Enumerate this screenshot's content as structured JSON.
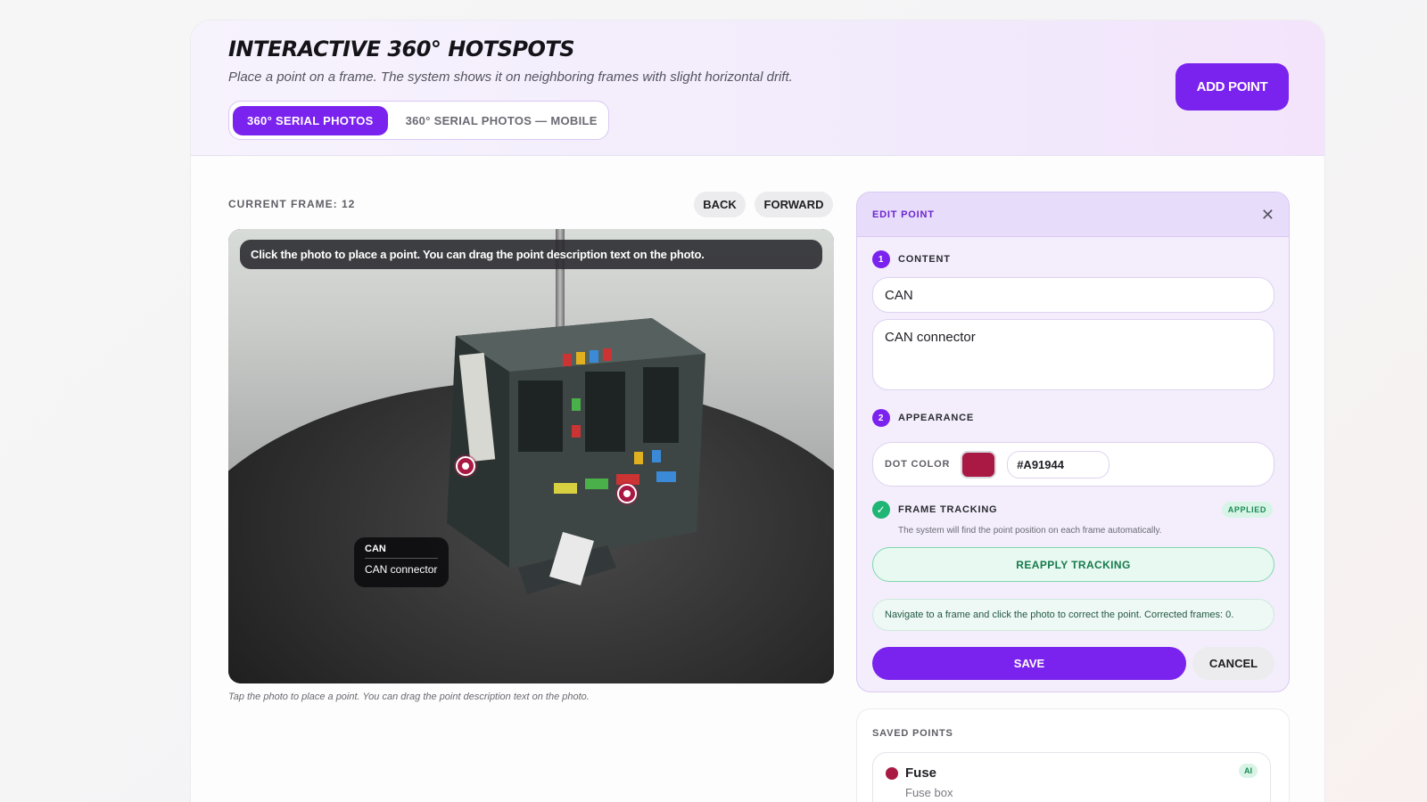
{
  "header": {
    "title": "INTERACTIVE 360° HOTSPOTS",
    "subtitle": "Place a point on a frame. The system shows it on neighboring frames with slight horizontal drift.",
    "add_point_label": "ADD POINT",
    "tabs": [
      {
        "label": "360° SERIAL PHOTOS",
        "active": true
      },
      {
        "label": "360° SERIAL PHOTOS — MOBILE",
        "active": false
      }
    ]
  },
  "viewer": {
    "current_frame_label": "CURRENT FRAME: 12",
    "back_label": "BACK",
    "forward_label": "FORWARD",
    "hint": "Click the photo to place a point. You can drag the point description text on the photo.",
    "caption": "Tap the photo to place a point. You can drag the point description text on the photo.",
    "callout": {
      "title": "CAN",
      "description": "CAN connector"
    }
  },
  "edit_point": {
    "header_label": "EDIT POINT",
    "content": {
      "step": "1",
      "label": "CONTENT",
      "title_value": "CAN",
      "description_value": "CAN connector"
    },
    "appearance": {
      "step": "2",
      "label": "APPEARANCE",
      "dot_color_label": "DOT COLOR",
      "dot_color_value": "#A91944"
    },
    "tracking": {
      "label": "FRAME TRACKING",
      "status": "APPLIED",
      "note": "The system will find the point position on each frame automatically.",
      "reapply_label": "REAPPLY TRACKING",
      "info": "Navigate to a frame and click the photo to correct the point. Corrected frames: 0."
    },
    "save_label": "SAVE",
    "cancel_label": "CANCEL"
  },
  "saved_points": {
    "label": "SAVED POINTS",
    "items": [
      {
        "name": "Fuse",
        "description": "Fuse box",
        "badge": "AI",
        "color": "#A91944"
      }
    ]
  },
  "colors": {
    "accent": "#7A22EE",
    "dot": "#A91944",
    "success": "#1FB574"
  }
}
